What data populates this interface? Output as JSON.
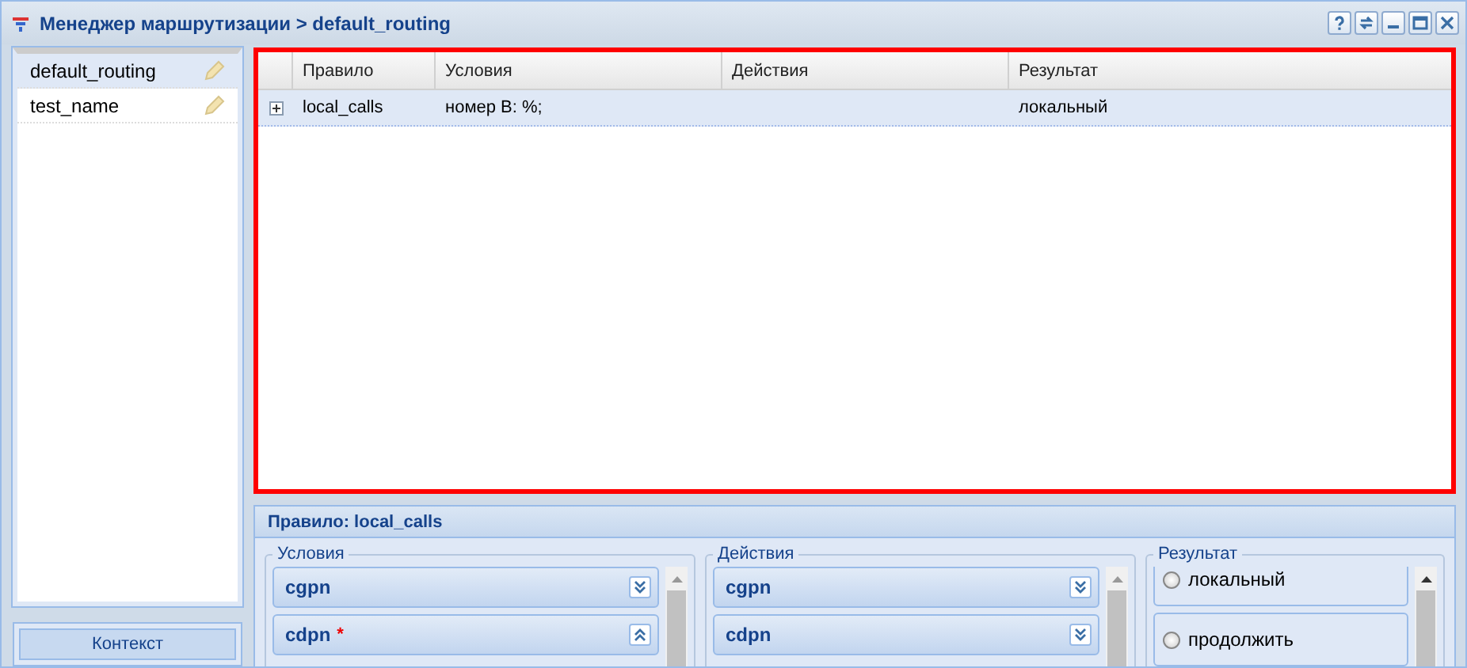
{
  "window": {
    "title": "Менеджер маршрутизации > default_routing"
  },
  "contexts": [
    {
      "name": "default_routing",
      "selected": true
    },
    {
      "name": "test_name",
      "selected": false
    }
  ],
  "context_button": "Контекст",
  "table": {
    "columns": [
      "Правило",
      "Условия",
      "Действия",
      "Результат"
    ],
    "rows": [
      {
        "expanded": false,
        "selected": true,
        "cells": [
          "local_calls",
          "номер B: %;",
          "",
          "локальный"
        ]
      }
    ]
  },
  "rule_panel": {
    "title": "Правило: local_calls",
    "conditions": {
      "legend": "Условия",
      "items": [
        {
          "name": "cgpn",
          "expanded": false
        },
        {
          "name": "cdpn",
          "marker": "*",
          "expanded": true
        }
      ]
    },
    "actions": {
      "legend": "Действия",
      "items": [
        {
          "name": "cgpn",
          "expanded": false
        },
        {
          "name": "cdpn",
          "expanded": false
        }
      ]
    },
    "result": {
      "legend": "Результат",
      "options": [
        {
          "label": "локальный",
          "selected": false
        },
        {
          "label": "продолжить",
          "selected": false
        }
      ]
    }
  }
}
